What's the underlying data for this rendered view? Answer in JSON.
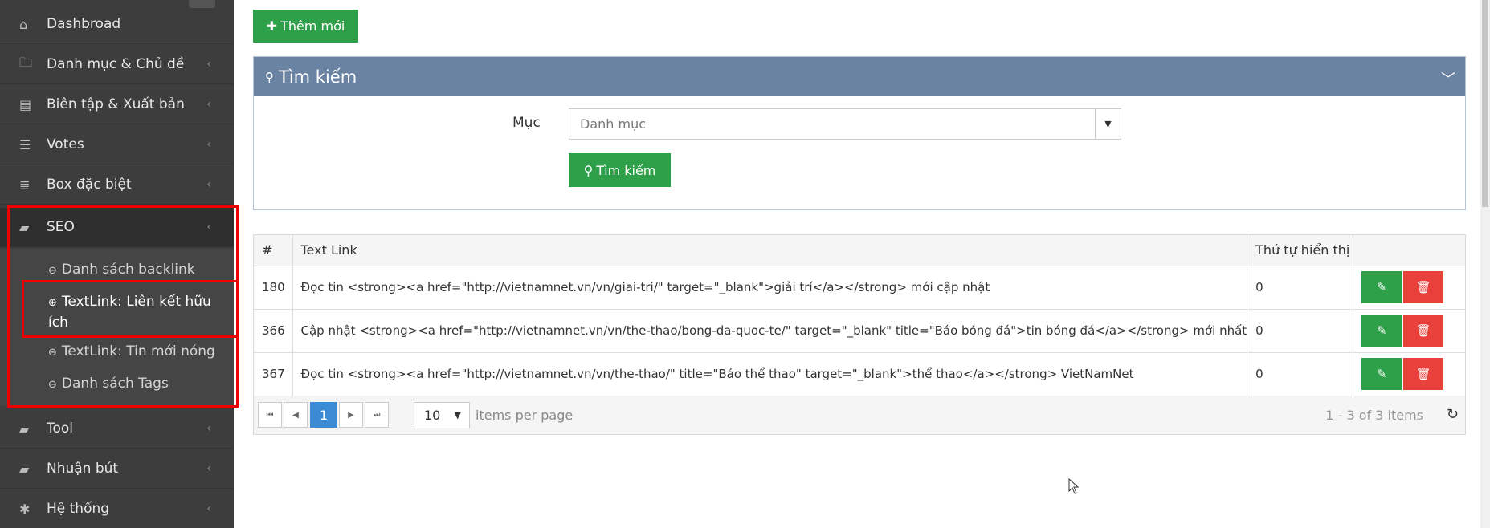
{
  "sidebar": {
    "items": [
      {
        "icon": "home-icon",
        "glyph": "⌂",
        "label": "Dashbroad",
        "chevron": ""
      },
      {
        "icon": "folder-icon",
        "glyph": "🗀",
        "label": "Danh mục & Chủ đề",
        "chevron": "‹"
      },
      {
        "icon": "newspaper-icon",
        "glyph": "▤",
        "label": "Biên tập & Xuất bản",
        "chevron": "‹"
      },
      {
        "icon": "list-alt-icon",
        "glyph": "☰",
        "label": "Votes",
        "chevron": "‹"
      },
      {
        "icon": "list-icon",
        "glyph": "≣",
        "label": "Box đặc biệt",
        "chevron": "‹"
      },
      {
        "icon": "book-icon",
        "glyph": "▰",
        "label": "SEO",
        "chevron": "‹"
      },
      {
        "icon": "book-icon",
        "glyph": "▰",
        "label": "Tool",
        "chevron": "‹"
      },
      {
        "icon": "book-icon",
        "glyph": "▰",
        "label": "Nhuận bút",
        "chevron": "‹"
      },
      {
        "icon": "gear-icon",
        "glyph": "✱",
        "label": "Hệ thống",
        "chevron": "‹"
      }
    ],
    "seo_submenu": [
      {
        "glyph": "⊖",
        "label": "Danh sách backlink"
      },
      {
        "glyph": "⊕",
        "label": "TextLink: Liên kết hữu ích"
      },
      {
        "glyph": "⊖",
        "label": "TextLink: Tin mới nóng"
      },
      {
        "glyph": "⊖",
        "label": "Danh sách Tags"
      }
    ]
  },
  "toolbar": {
    "add_icon": "✚",
    "add_label": "Thêm mới"
  },
  "search_panel": {
    "title_icon": "⚲",
    "title": "Tìm kiếm",
    "collapse_glyph": "﹀",
    "field_label": "Mục",
    "select_value": "Danh mục",
    "select_arrow": "▼",
    "button_icon": "⚲",
    "button_label": "Tìm kiếm"
  },
  "grid": {
    "headers": [
      "#",
      "Text Link",
      "Thứ tự hiển thị",
      ""
    ],
    "rows": [
      {
        "id": "180",
        "text": "Đọc tin <strong><a href=\"http://vietnamnet.vn/vn/giai-tri/\" target=\"_blank\">giải trí</a></strong> mới cập nhật",
        "order": "0"
      },
      {
        "id": "366",
        "text": "Cập nhật <strong><a href=\"http://vietnamnet.vn/vn/the-thao/bong-da-quoc-te/\" target=\"_blank\" title=\"Báo bóng đá\">tin bóng đá</a></strong> mới nhất",
        "order": "0"
      },
      {
        "id": "367",
        "text": "Đọc tin <strong><a href=\"http://vietnamnet.vn/vn/the-thao/\" title=\"Báo thể thao\" target=\"_blank\">thể thao</a></strong> VietNamNet",
        "order": "0"
      }
    ],
    "edit_glyph": "✎",
    "delete_glyph": "🗑"
  },
  "pager": {
    "first": "⏮",
    "prev": "◀",
    "current_page": "1",
    "next": "▶",
    "last": "⏭",
    "page_size": "10",
    "page_size_arrow": "▼",
    "items_per_page": "items per page",
    "info": "1 - 3 of 3 items",
    "refresh_glyph": "↻"
  },
  "colors": {
    "sidebar": "#3d3d3d",
    "primary": "#2ea04a",
    "danger": "#e8403a",
    "panel_header": "#6b83a3",
    "page_active": "#3a8ad4",
    "highlight": "#ee0000"
  }
}
